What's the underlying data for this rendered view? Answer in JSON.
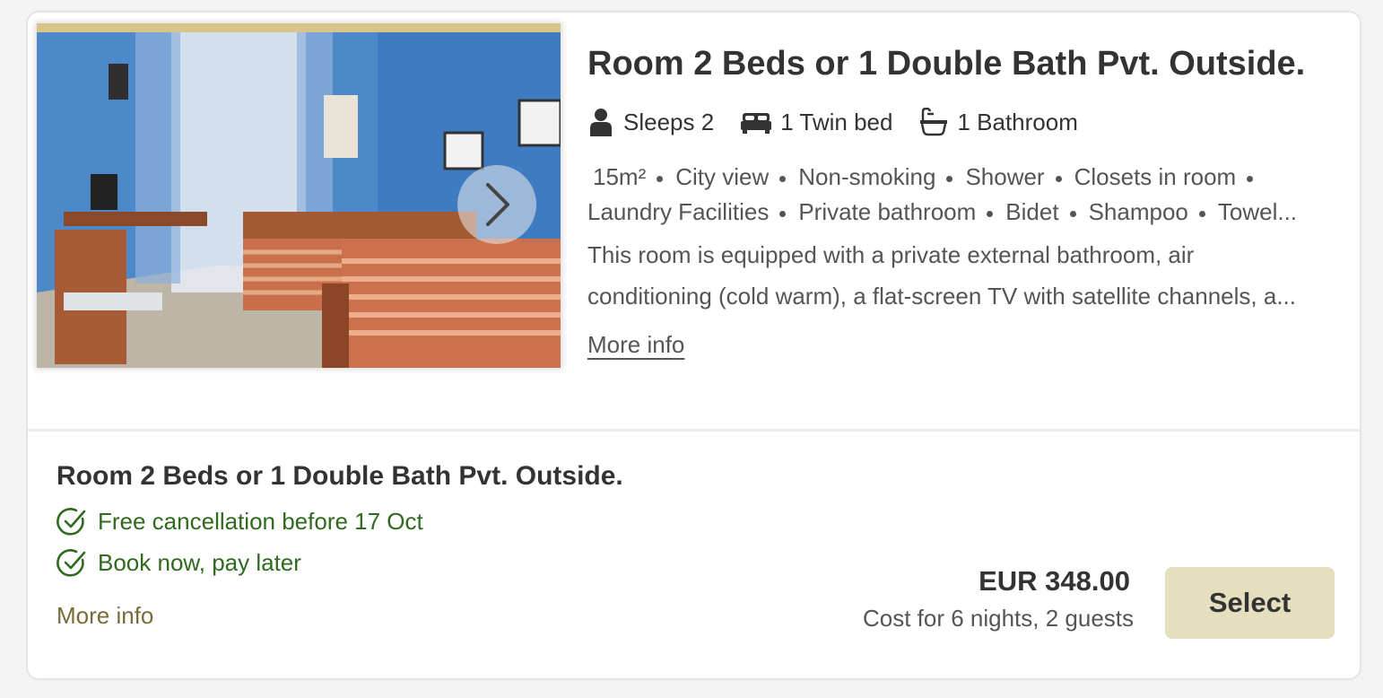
{
  "room": {
    "title": "Room 2 Beds or 1 Double Bath Pvt. Outside.",
    "facts": [
      {
        "icon": "person-icon",
        "label": "Sleeps 2"
      },
      {
        "icon": "bed-icon",
        "label": "1 Twin bed"
      },
      {
        "icon": "bathtub-icon",
        "label": "1 Bathroom"
      }
    ],
    "amenities_line1": [
      "15m²",
      "City view",
      "Non-smoking",
      "Shower",
      "Closets in room"
    ],
    "amenities_line2": [
      "Laundry Facilities",
      "Private bathroom",
      "Bidet",
      "Shampoo",
      "Towel..."
    ],
    "description_line1": "This room is equipped with a private external bathroom, air",
    "description_line2": "conditioning (cold warm), a flat-screen TV with satellite channels, a...",
    "more_info_label": "More info",
    "carousel_icon": "chevron-right-icon"
  },
  "rate": {
    "title": "Room 2 Beds or 1 Double Bath Pvt. Outside.",
    "perks": [
      {
        "icon": "check-circle-icon",
        "label": "Free cancellation before 17 Oct"
      },
      {
        "icon": "check-circle-icon",
        "label": "Book now, pay later"
      }
    ],
    "more_info_label": "More info",
    "price": "EUR 348.00",
    "cost_note": "Cost for 6 nights, 2 guests",
    "select_label": "Select"
  },
  "colors": {
    "perk_green": "#2f6a1f",
    "select_bg": "#e5dfbf",
    "more_info_gold": "#7a6a3a"
  }
}
